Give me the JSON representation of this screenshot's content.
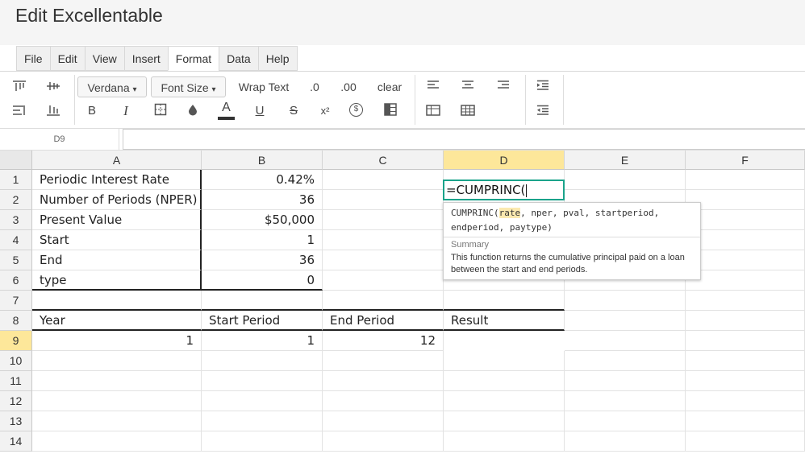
{
  "app": {
    "title": "Edit Excellentable"
  },
  "menu": [
    {
      "label": "File"
    },
    {
      "label": "Edit"
    },
    {
      "label": "View"
    },
    {
      "label": "Insert"
    },
    {
      "label": "Format"
    },
    {
      "label": "Data"
    },
    {
      "label": "Help"
    }
  ],
  "toolbar": {
    "font_family": "Verdana",
    "font_size": "Font Size",
    "wrap_text": "Wrap Text",
    "decimal_decrease": ".0",
    "decimal_increase": ".00",
    "clear": "clear",
    "bold": "B",
    "italic": "I",
    "strike": "S",
    "superscript": "x²",
    "font_color": "A",
    "underline": "U",
    "currency": "$",
    "dropdown_caret": "▾"
  },
  "formula_bar": {
    "cell_ref": "D9",
    "value": ""
  },
  "columns": [
    "A",
    "B",
    "C",
    "D",
    "E",
    "F"
  ],
  "rows": [
    "1",
    "2",
    "3",
    "4",
    "5",
    "6",
    "7",
    "8",
    "9",
    "10",
    "11",
    "12",
    "13",
    "14"
  ],
  "cells": {
    "A1": "Periodic Interest Rate",
    "B1": "0.42%",
    "A2": "Number of Periods (NPER)",
    "B2": "36",
    "A3": "Present Value",
    "B3": "$50,000",
    "A4": "Start",
    "B4": "1",
    "A5": "End",
    "B5": "36",
    "A6": "type",
    "B6": "0",
    "A8": "Year",
    "B8": "Start Period",
    "C8": "End Period",
    "D8": "Result",
    "A9": "1",
    "B9": "1",
    "C9": "12"
  },
  "active_cell": {
    "ref": "D9",
    "value": "=CUMPRINC("
  },
  "tooltip": {
    "fn": "CUMPRINC(",
    "arg_highlight": "rate",
    "rest_line1": ", nper, pval, startperiod,",
    "line2": "endperiod, paytype)",
    "summary_heading": "Summary",
    "summary": "This function returns the cumulative principal paid on a loan between the start and end periods."
  },
  "colors": {
    "accent": "#1aa38a",
    "selected_header": "#fde79a"
  }
}
